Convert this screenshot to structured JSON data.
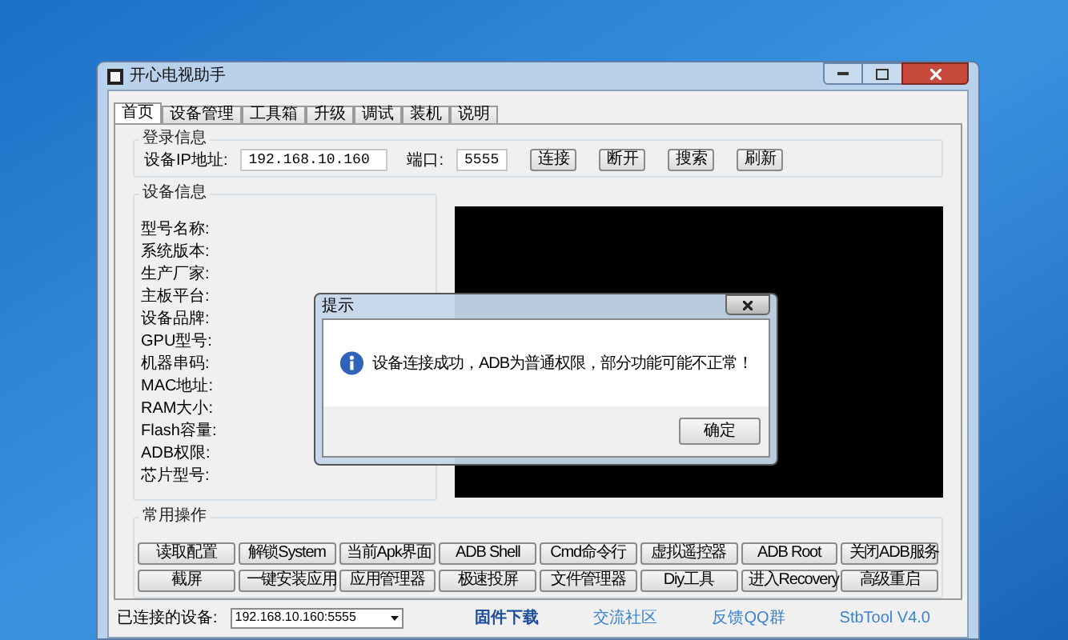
{
  "window": {
    "title": "开心电视助手"
  },
  "tabs": [
    {
      "label": "首页",
      "selected": true
    },
    {
      "label": "设备管理",
      "selected": false
    },
    {
      "label": "工具箱",
      "selected": false
    },
    {
      "label": "升级",
      "selected": false
    },
    {
      "label": "调试",
      "selected": false
    },
    {
      "label": "装机",
      "selected": false
    },
    {
      "label": "说明",
      "selected": false
    }
  ],
  "login": {
    "title": "登录信息",
    "ip_label": "设备IP地址:",
    "ip_value": "192.168.10.160",
    "port_label": "端口:",
    "port_value": "5555",
    "buttons": [
      "连接",
      "断开",
      "搜索",
      "刷新"
    ]
  },
  "device_info": {
    "title": "设备信息",
    "fields": [
      "型号名称:",
      "系统版本:",
      "生产厂家:",
      "主板平台:",
      "设备品牌:",
      "GPU型号:",
      "机器串码:",
      "MAC地址:",
      "RAM大小:",
      "Flash容量:",
      "ADB权限:",
      "芯片型号:"
    ]
  },
  "common_ops": {
    "title": "常用操作",
    "buttons": [
      "读取配置",
      "解锁System",
      "当前Apk界面",
      "ADB Shell",
      "Cmd命令行",
      "虚拟遥控器",
      "ADB  Root",
      "关闭ADB服务",
      "截屏",
      "一键安装应用",
      "应用管理器",
      "极速投屏",
      "文件管理器",
      "Diy工具",
      "进入Recovery",
      "高级重启"
    ]
  },
  "status_bar": {
    "device_label": "已连接的设备:",
    "device_value": "192.168.10.160:5555",
    "links": [
      {
        "label": "固件下载",
        "emphasized": true
      },
      {
        "label": "交流社区",
        "emphasized": false
      },
      {
        "label": "反馈QQ群",
        "emphasized": false
      },
      {
        "label": "StbTool V4.0",
        "emphasized": false
      }
    ]
  },
  "dialog": {
    "title": "提示",
    "message": "设备连接成功，ADB为普通权限，部分功能可能不正常！",
    "ok": "确定"
  }
}
